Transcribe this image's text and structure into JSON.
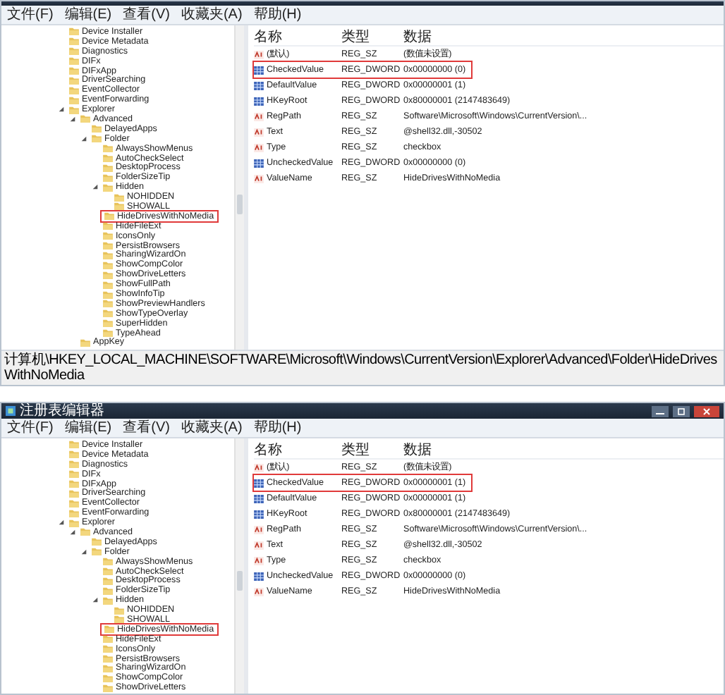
{
  "panels": [
    {
      "menu": [
        "文件(F)",
        "编辑(E)",
        "查看(V)",
        "收藏夹(A)",
        "帮助(H)"
      ],
      "tree": [
        {
          "label": "Device Installer",
          "marked": false
        },
        {
          "label": "Device Metadata",
          "marked": false
        },
        {
          "label": "Diagnostics",
          "marked": false
        },
        {
          "label": "DIFx",
          "marked": false
        },
        {
          "label": "DIFxApp",
          "marked": false
        },
        {
          "label": "DriverSearching",
          "marked": false
        },
        {
          "label": "EventCollector",
          "marked": false
        },
        {
          "label": "EventForwarding",
          "marked": false
        },
        {
          "label": "Explorer",
          "marked": false,
          "expanded": true,
          "children": [
            {
              "label": "Advanced",
              "marked": false,
              "expanded": true,
              "children": [
                {
                  "label": "DelayedApps",
                  "marked": false
                },
                {
                  "label": "Folder",
                  "marked": false,
                  "expanded": true,
                  "children": [
                    {
                      "label": "AlwaysShowMenus",
                      "marked": false
                    },
                    {
                      "label": "AutoCheckSelect",
                      "marked": false
                    },
                    {
                      "label": "DesktopProcess",
                      "marked": false
                    },
                    {
                      "label": "FolderSizeTip",
                      "marked": false
                    },
                    {
                      "label": "Hidden",
                      "marked": false,
                      "expanded": true,
                      "children": [
                        {
                          "label": "NOHIDDEN",
                          "marked": false
                        },
                        {
                          "label": "SHOWALL",
                          "marked": false
                        }
                      ]
                    },
                    {
                      "label": "HideDrivesWithNoMedia",
                      "marked": true
                    },
                    {
                      "label": "HideFileExt",
                      "marked": false
                    },
                    {
                      "label": "IconsOnly",
                      "marked": false
                    },
                    {
                      "label": "PersistBrowsers",
                      "marked": false
                    },
                    {
                      "label": "SharingWizardOn",
                      "marked": false
                    },
                    {
                      "label": "ShowCompColor",
                      "marked": false
                    },
                    {
                      "label": "ShowDriveLetters",
                      "marked": false
                    },
                    {
                      "label": "ShowFullPath",
                      "marked": false
                    },
                    {
                      "label": "ShowInfoTip",
                      "marked": false
                    },
                    {
                      "label": "ShowPreviewHandlers",
                      "marked": false
                    },
                    {
                      "label": "ShowTypeOverlay",
                      "marked": false
                    },
                    {
                      "label": "SuperHidden",
                      "marked": false
                    },
                    {
                      "label": "TypeAhead",
                      "marked": false
                    }
                  ]
                }
              ]
            },
            {
              "label": "AppKey",
              "marked": false
            }
          ]
        }
      ],
      "columns": [
        "名称",
        "类型",
        "数据"
      ],
      "values": [
        {
          "kind": "string",
          "name": "(默认)",
          "type": "REG_SZ",
          "data": "(数值未设置)",
          "marked": false
        },
        {
          "kind": "number",
          "name": "CheckedValue",
          "type": "REG_DWORD",
          "data": "0x00000000 (0)",
          "marked": true
        },
        {
          "kind": "number",
          "name": "DefaultValue",
          "type": "REG_DWORD",
          "data": "0x00000001 (1)",
          "marked": false
        },
        {
          "kind": "number",
          "name": "HKeyRoot",
          "type": "REG_DWORD",
          "data": "0x80000001 (2147483649)",
          "marked": false
        },
        {
          "kind": "string",
          "name": "RegPath",
          "type": "REG_SZ",
          "data": "Software\\Microsoft\\Windows\\CurrentVersion\\...",
          "marked": false
        },
        {
          "kind": "string",
          "name": "Text",
          "type": "REG_SZ",
          "data": "@shell32.dll,-30502",
          "marked": false
        },
        {
          "kind": "string",
          "name": "Type",
          "type": "REG_SZ",
          "data": "checkbox",
          "marked": false
        },
        {
          "kind": "number",
          "name": "UncheckedValue",
          "type": "REG_DWORD",
          "data": "0x00000000 (0)",
          "marked": false
        },
        {
          "kind": "string",
          "name": "ValueName",
          "type": "REG_SZ",
          "data": "HideDrivesWithNoMedia",
          "marked": false
        }
      ],
      "status_bar": "计算机\\HKEY_LOCAL_MACHINE\\SOFTWARE\\Microsoft\\Windows\\CurrentVersion\\Explorer\\Advanced\\Folder\\HideDrivesWithNoMedia"
    },
    {
      "title_bar": {
        "title": "注册表编辑器"
      },
      "menu": [
        "文件(F)",
        "编辑(E)",
        "查看(V)",
        "收藏夹(A)",
        "帮助(H)"
      ],
      "tree": [
        {
          "label": "Device Installer",
          "marked": false
        },
        {
          "label": "Device Metadata",
          "marked": false
        },
        {
          "label": "Diagnostics",
          "marked": false
        },
        {
          "label": "DIFx",
          "marked": false
        },
        {
          "label": "DIFxApp",
          "marked": false
        },
        {
          "label": "DriverSearching",
          "marked": false
        },
        {
          "label": "EventCollector",
          "marked": false
        },
        {
          "label": "EventForwarding",
          "marked": false
        },
        {
          "label": "Explorer",
          "marked": false,
          "expanded": true,
          "children": [
            {
              "label": "Advanced",
              "marked": false,
              "expanded": true,
              "children": [
                {
                  "label": "DelayedApps",
                  "marked": false
                },
                {
                  "label": "Folder",
                  "marked": false,
                  "expanded": true,
                  "children": [
                    {
                      "label": "AlwaysShowMenus",
                      "marked": false
                    },
                    {
                      "label": "AutoCheckSelect",
                      "marked": false
                    },
                    {
                      "label": "DesktopProcess",
                      "marked": false
                    },
                    {
                      "label": "FolderSizeTip",
                      "marked": false
                    },
                    {
                      "label": "Hidden",
                      "marked": false,
                      "expanded": true,
                      "children": [
                        {
                          "label": "NOHIDDEN",
                          "marked": false
                        },
                        {
                          "label": "SHOWALL",
                          "marked": false
                        }
                      ]
                    },
                    {
                      "label": "HideDrivesWithNoMedia",
                      "marked": true
                    },
                    {
                      "label": "HideFileExt",
                      "marked": false
                    },
                    {
                      "label": "IconsOnly",
                      "marked": false
                    },
                    {
                      "label": "PersistBrowsers",
                      "marked": false
                    },
                    {
                      "label": "SharingWizardOn",
                      "marked": false
                    },
                    {
                      "label": "ShowCompColor",
                      "marked": false
                    },
                    {
                      "label": "ShowDriveLetters",
                      "marked": false
                    }
                  ]
                }
              ]
            }
          ]
        }
      ],
      "columns": [
        "名称",
        "类型",
        "数据"
      ],
      "values": [
        {
          "kind": "string",
          "name": "(默认)",
          "type": "REG_SZ",
          "data": "(数值未设置)",
          "marked": false
        },
        {
          "kind": "number",
          "name": "CheckedValue",
          "type": "REG_DWORD",
          "data": "0x00000001 (1)",
          "marked": true
        },
        {
          "kind": "number",
          "name": "DefaultValue",
          "type": "REG_DWORD",
          "data": "0x00000001 (1)",
          "marked": false
        },
        {
          "kind": "number",
          "name": "HKeyRoot",
          "type": "REG_DWORD",
          "data": "0x80000001 (2147483649)",
          "marked": false
        },
        {
          "kind": "string",
          "name": "RegPath",
          "type": "REG_SZ",
          "data": "Software\\Microsoft\\Windows\\CurrentVersion\\...",
          "marked": false
        },
        {
          "kind": "string",
          "name": "Text",
          "type": "REG_SZ",
          "data": "@shell32.dll,-30502",
          "marked": false
        },
        {
          "kind": "string",
          "name": "Type",
          "type": "REG_SZ",
          "data": "checkbox",
          "marked": false
        },
        {
          "kind": "number",
          "name": "UncheckedValue",
          "type": "REG_DWORD",
          "data": "0x00000000 (0)",
          "marked": false
        },
        {
          "kind": "string",
          "name": "ValueName",
          "type": "REG_SZ",
          "data": "HideDrivesWithNoMedia",
          "marked": false
        }
      ]
    }
  ]
}
